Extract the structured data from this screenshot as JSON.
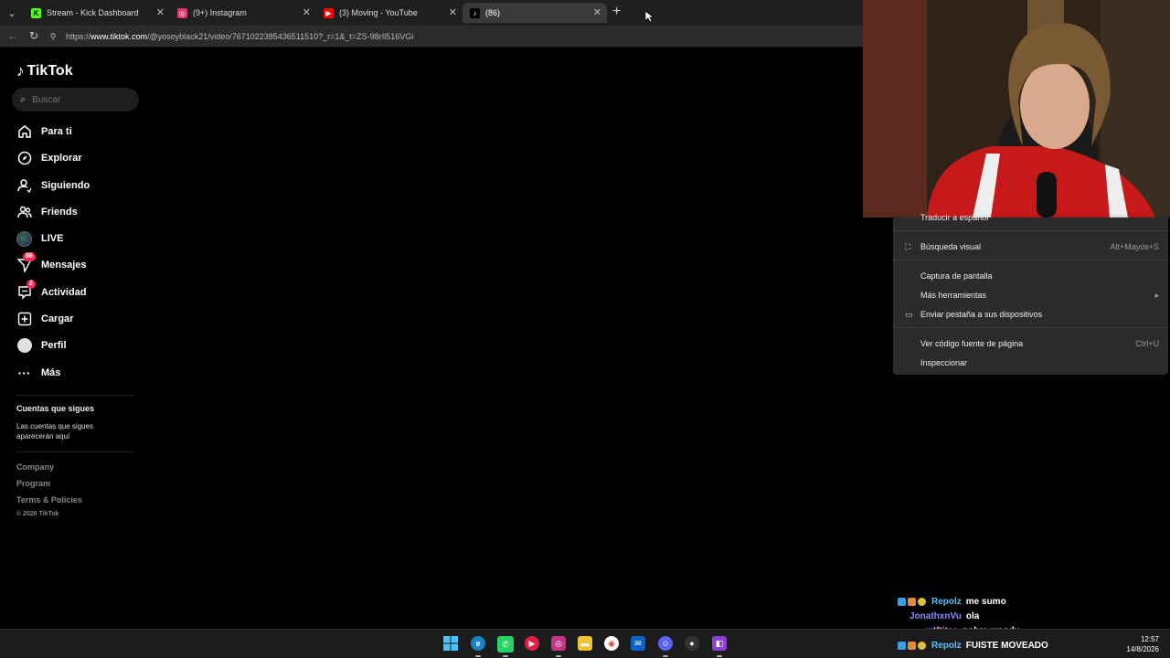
{
  "browser": {
    "tabs": [
      {
        "title": "Stream - Kick Dashboard",
        "favicon": "K",
        "color": "#53fc18"
      },
      {
        "title": "(9+) Instagram",
        "favicon": "◎",
        "color": "#e1306c"
      },
      {
        "title": "(3) Moving - YouTube",
        "favicon": "▶",
        "color": "#ff0000"
      },
      {
        "title": "(86)",
        "favicon": "♪",
        "color": "#000000"
      }
    ],
    "url_prefix": "https://",
    "url_host": "www.tiktok.com",
    "url_path": "/@yosoyblack21/video/7671022385436511510?_r=1&_t=ZS-98rIl516VGi"
  },
  "tiktok": {
    "logo": "TikTok",
    "search_placeholder": "Buscar",
    "nav": [
      {
        "label": "Para ti",
        "icon": "home-icon"
      },
      {
        "label": "Explorar",
        "icon": "compass-icon"
      },
      {
        "label": "Siguiendo",
        "icon": "following-icon"
      },
      {
        "label": "Friends",
        "icon": "friends-icon"
      },
      {
        "label": "LIVE",
        "icon": "live-icon"
      },
      {
        "label": "Mensajes",
        "icon": "messages-icon",
        "badge": "86"
      },
      {
        "label": "Actividad",
        "icon": "activity-icon",
        "badge": "2"
      },
      {
        "label": "Cargar",
        "icon": "upload-icon"
      },
      {
        "label": "Perfil",
        "icon": "profile-icon"
      },
      {
        "label": "Más",
        "icon": "more-icon"
      }
    ],
    "following_title": "Cuentas que sigues",
    "following_text": "Las cuentas que sigues aparecerán aquí",
    "footer": [
      "Company",
      "Program",
      "Terms & Policies"
    ],
    "copyright": "© 2026 TikTok"
  },
  "context_menu": {
    "items": [
      {
        "label": "Traducir a español",
        "shortcut": "",
        "icon": ""
      },
      {
        "label": "Búsqueda visual",
        "shortcut": "Alt+Mayús+S",
        "icon": "visual-search-icon"
      },
      {
        "label": "Captura de pantalla",
        "shortcut": "",
        "icon": ""
      },
      {
        "label": "Más herramientas",
        "shortcut": "",
        "icon": "",
        "submenu": true
      },
      {
        "label": "Enviar pestaña a sus dispositivos",
        "shortcut": "",
        "icon": "send-tab-icon"
      },
      {
        "label": "Ver código fuente de página",
        "shortcut": "Ctrl+U",
        "icon": ""
      },
      {
        "label": "Inspeccionar",
        "shortcut": "",
        "icon": ""
      }
    ]
  },
  "chat": [
    {
      "user": "Repolz",
      "message": "me sumo",
      "color": "#5bc0f8",
      "badges": true
    },
    {
      "user": "JonathxnVu",
      "message": "ola",
      "color": "#8a8cff",
      "badges": false
    },
    {
      "user": "wtftitaa",
      "message": "pobre woody",
      "color": "#e6a8ff",
      "badges": false
    },
    {
      "user": "Repolz",
      "message": "FUISTE MOVEADO",
      "color": "#5bc0f8",
      "badges": true
    }
  ],
  "taskbar": {
    "time": "12:57",
    "date": "14/8/2026"
  }
}
